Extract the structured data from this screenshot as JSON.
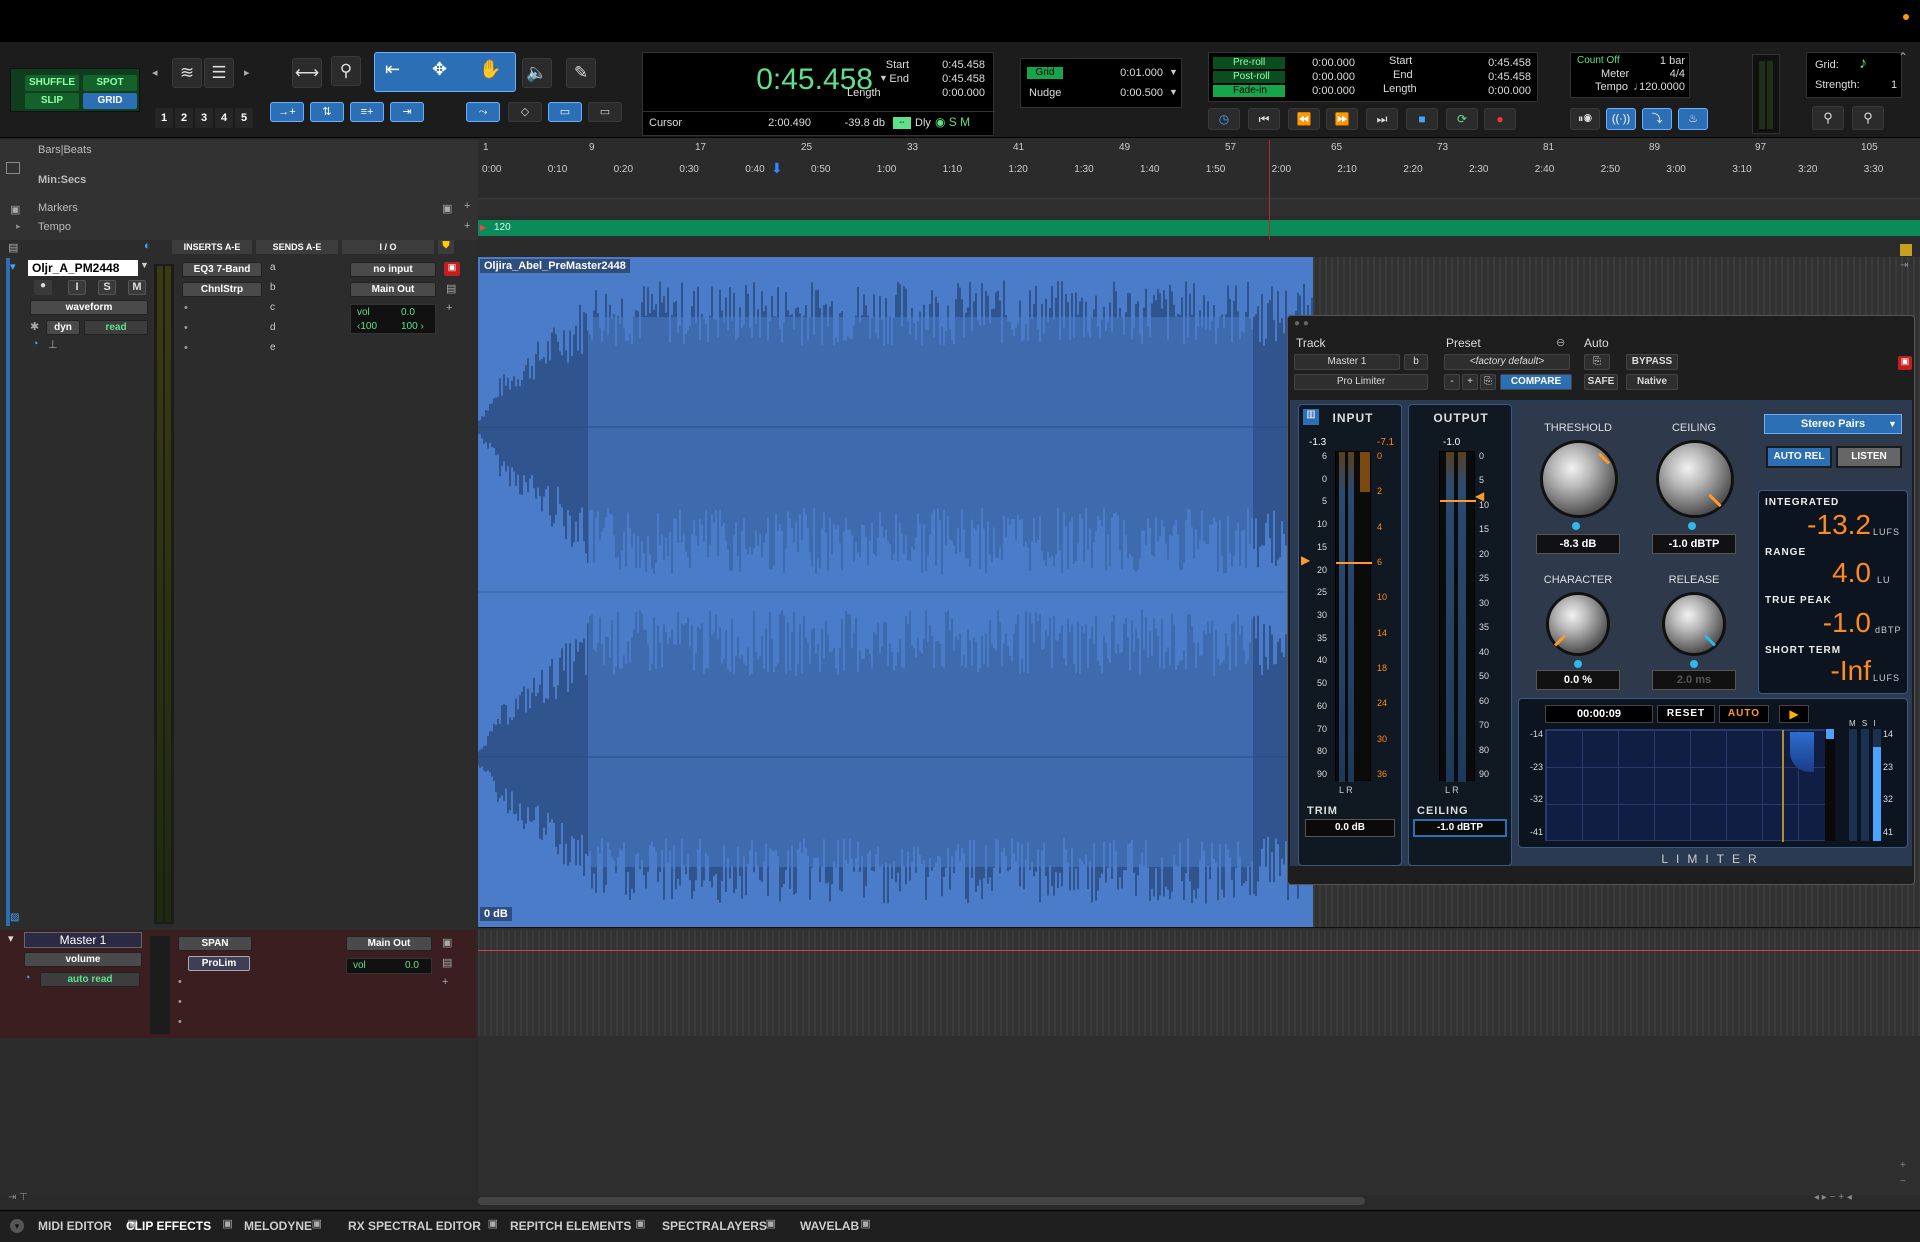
{
  "toolbar": {
    "modes": {
      "shuffle": "SHUFFLE",
      "spot": "SPOT",
      "slip": "SLIP",
      "grid": "GRID"
    },
    "zoom_presets": [
      "1",
      "2",
      "3",
      "4",
      "5"
    ],
    "main_counter": "0:45.458",
    "selection": {
      "start_label": "Start",
      "end_label": "End",
      "length_label": "Length",
      "start": "0:45.458",
      "end": "0:45.458",
      "length": "0:00.000"
    },
    "cursor_label": "Cursor",
    "cursor_value": "2:00.490",
    "cursor_db": "-39.8 db",
    "dly_label": "Dly",
    "grid_label": "Grid",
    "grid_value": "0:01.000",
    "nudge_label": "Nudge",
    "nudge_value": "0:00.500",
    "preroll_label": "Pre-roll",
    "postroll_label": "Post-roll",
    "fadein_label": "Fade-in",
    "preroll_value": "0:00.000",
    "postroll_value": "0:00.000",
    "fadein_value": "0:00.000",
    "transport_sel": {
      "start": "0:45.458",
      "end": "0:45.458",
      "length": "0:00.000"
    },
    "countoff_label": "Count Off",
    "countoff_value": "1 bar",
    "meter_label": "Meter",
    "meter_value": "4/4",
    "tempo_label": "Tempo",
    "tempo_value": "120.0000",
    "grid_right_label": "Grid:",
    "strength_label": "Strength:",
    "strength_value": "1"
  },
  "rulers": {
    "bars_label": "Bars|Beats",
    "minsecs_label": "Min:Secs",
    "markers_label": "Markers",
    "tempo_label": "Tempo",
    "tempo_value": "120",
    "bars": [
      "1",
      "9",
      "17",
      "25",
      "33",
      "41",
      "49",
      "57",
      "65",
      "73",
      "81",
      "89",
      "97",
      "105"
    ],
    "times": [
      "0:00",
      "0:10",
      "0:20",
      "0:30",
      "0:40",
      "0:50",
      "1:00",
      "1:10",
      "1:20",
      "1:30",
      "1:40",
      "1:50",
      "2:00",
      "2:10",
      "2:20",
      "2:30",
      "2:40",
      "2:50",
      "3:00",
      "3:10",
      "3:20",
      "3:30"
    ]
  },
  "columns": {
    "inserts": "INSERTS A-E",
    "sends": "SENDS A-E",
    "io": "I / O"
  },
  "track1": {
    "name": "Oljr_A_PM2448",
    "buttons": [
      "I",
      "S",
      "M"
    ],
    "view": "waveform",
    "auto_type": "dyn",
    "auto_mode": "read",
    "inserts": [
      "EQ3 7-Band",
      "ChnlStrp"
    ],
    "send_slots": [
      "a",
      "b",
      "c",
      "d",
      "e"
    ],
    "input": "no input",
    "output": "Main Out",
    "vol_label": "vol",
    "vol_value": "0.0",
    "pan_left": "‹100",
    "pan_right": "100 ›",
    "clip_name": "Oljira_Abel_PreMaster2448",
    "clip_gain": "0 dB"
  },
  "master": {
    "name": "Master 1",
    "view": "volume",
    "auto_mode": "auto read",
    "inserts": [
      "SPAN",
      "ProLim"
    ],
    "output": "Main Out",
    "vol_label": "vol",
    "vol_value": "0.0"
  },
  "plugin": {
    "track_label": "Track",
    "preset_label": "Preset",
    "auto_label": "Auto",
    "track_value": "Master 1",
    "track_slot": "b",
    "preset_value": "<factory default>",
    "plugin_name": "Pro Limiter",
    "bypass": "BYPASS",
    "compare": "COMPARE",
    "safe": "SAFE",
    "native": "Native",
    "input_title": "INPUT",
    "output_title": "OUTPUT",
    "input_peak_l": "-1.3",
    "input_peak_r": "-7.1",
    "output_peak": "-1.0",
    "input_scale": [
      "6",
      "0",
      "5",
      "10",
      "15",
      "20",
      "25",
      "30",
      "35",
      "40",
      "50",
      "60",
      "70",
      "80",
      "90"
    ],
    "gr_scale": [
      "0",
      "2",
      "4",
      "6",
      "10",
      "14",
      "18",
      "24",
      "30",
      "36"
    ],
    "output_scale": [
      "0",
      "5",
      "10",
      "15",
      "20",
      "25",
      "30",
      "35",
      "40",
      "50",
      "60",
      "70",
      "80",
      "90"
    ],
    "lr": "L R",
    "trim_label": "TRIM",
    "trim_value": "0.0 dB",
    "ceiling_label": "CEILING",
    "ceiling_value": "-1.0 dBTP",
    "threshold_label": "THRESHOLD",
    "threshold_value": "-8.3 dB",
    "ceiling_knob_label": "CEILING",
    "ceiling_knob_value": "-1.0 dBTP",
    "character_label": "CHARACTER",
    "character_value": "0.0 %",
    "release_label": "RELEASE",
    "release_value": "2.0 ms",
    "mode": "Stereo Pairs",
    "auto_rel": "AUTO REL",
    "listen": "LISTEN",
    "integrated_label": "INTEGRATED",
    "integrated_value": "-13.2",
    "integrated_unit": "LUFS",
    "range_label": "RANGE",
    "range_value": "4.0",
    "range_unit": "LU",
    "truepeak_label": "TRUE PEAK",
    "truepeak_value": "-1.0",
    "truepeak_unit": "dBTP",
    "shortterm_label": "SHORT TERM",
    "shortterm_value": "-Inf",
    "shortterm_unit": "LUFS",
    "history_time": "00:00:09",
    "reset": "RESET",
    "auto": "AUTO",
    "history_scale": [
      "-14",
      "-23",
      "-32",
      "-41"
    ],
    "msi": "M S I",
    "footer": "LIMITER"
  },
  "bottom_tabs": [
    "MIDI EDITOR",
    "CLIP EFFECTS",
    "MELODYNE",
    "RX SPECTRAL EDITOR",
    "REPITCH ELEMENTS",
    "SPECTRALAYERS",
    "WAVELAB"
  ],
  "colors": {
    "accent_blue": "#2c6fb4",
    "waveform": "#4a7cc9",
    "counter_green": "#5fe08a",
    "loudness_orange": "#ff8a1e",
    "tempo_green": "#0d8a5a"
  }
}
